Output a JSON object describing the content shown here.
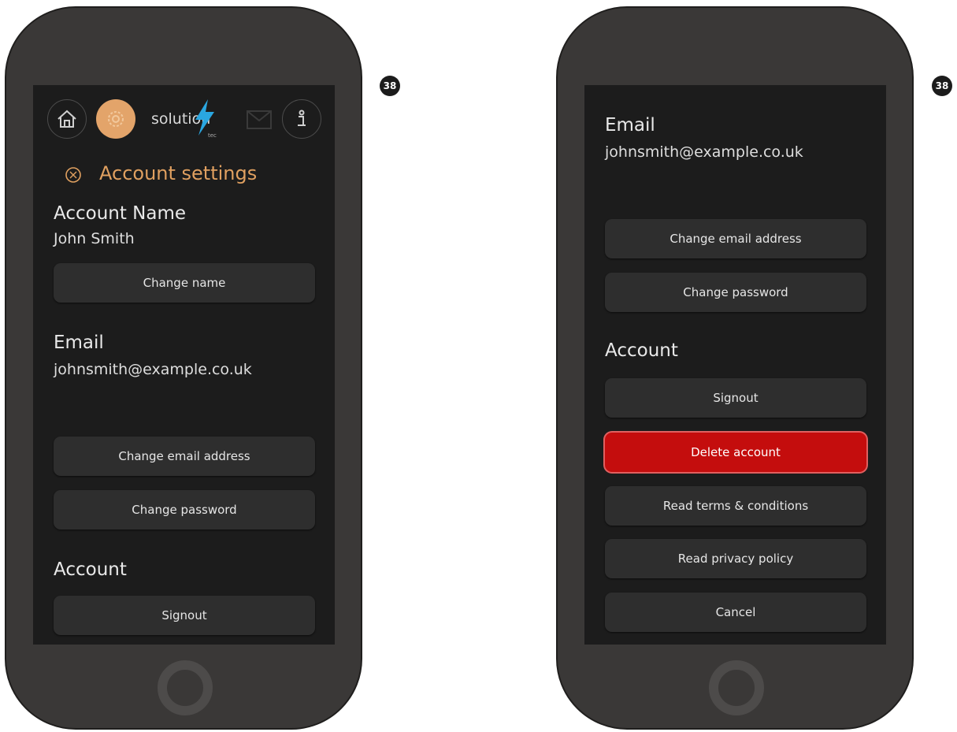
{
  "badge_number": "38",
  "colors": {
    "accent": "#e0a060",
    "danger": "#c40d0d",
    "bolt": "#2aa6e0"
  },
  "left": {
    "logo_text": "solution",
    "logo_sub": "tec",
    "section_title": "Account settings",
    "account_name_label": "Account Name",
    "account_name_value": "John Smith",
    "change_name": "Change name",
    "email_label": "Email",
    "email_value": "johnsmith@example.co.uk",
    "change_email": "Change email address",
    "change_password": "Change password",
    "account_label": "Account",
    "signout": "Signout"
  },
  "right": {
    "email_label": "Email",
    "email_value": "johnsmith@example.co.uk",
    "change_email": "Change email address",
    "change_password": "Change password",
    "account_label": "Account",
    "signout": "Signout",
    "delete_account": "Delete account",
    "terms": "Read terms & conditions",
    "privacy": "Read privacy policy",
    "cancel": "Cancel"
  }
}
